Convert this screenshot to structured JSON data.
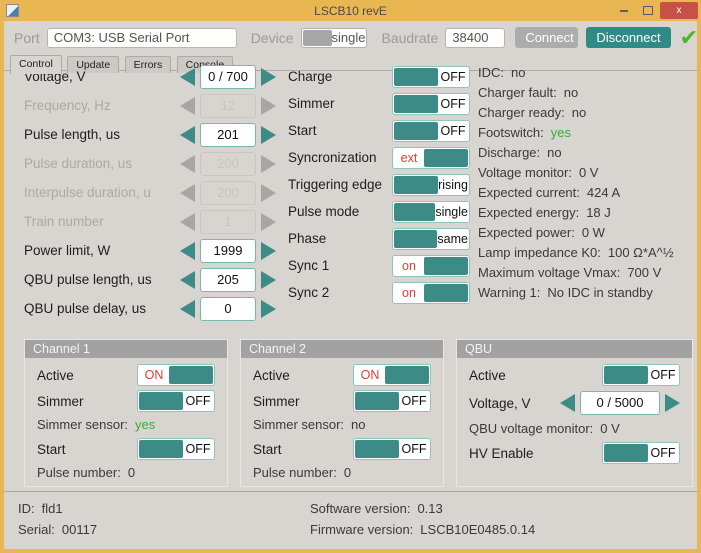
{
  "window": {
    "title": "LSCB10 revE",
    "close_glyph": "x"
  },
  "toolbar": {
    "port_label": "Port",
    "port_value": "COM3: USB Serial Port",
    "device_label": "Device",
    "device_value": "single",
    "baudrate_label": "Baudrate",
    "baudrate_value": "38400",
    "connect_label": "Connect",
    "disconnect_label": "Disconnect",
    "status_check_glyph": "✔"
  },
  "tabs": [
    {
      "label": "Control",
      "active": true
    },
    {
      "label": "Update",
      "active": false
    },
    {
      "label": "Errors",
      "active": false
    },
    {
      "label": "Console",
      "active": false
    }
  ],
  "params": [
    {
      "label": "Voltage, V",
      "value": "0 / 700",
      "enabled": true
    },
    {
      "label": "Frequency, Hz",
      "value": "12",
      "enabled": false
    },
    {
      "label": "Pulse length, us",
      "value": "201",
      "enabled": true
    },
    {
      "label": "Pulse duration, us",
      "value": "200",
      "enabled": false
    },
    {
      "label": "Interpulse duration, u",
      "value": "200",
      "enabled": false
    },
    {
      "label": "Train number",
      "value": "1",
      "enabled": false
    },
    {
      "label": "Power limit, W",
      "value": "1999",
      "enabled": true
    },
    {
      "label": "QBU pulse length, us",
      "value": "205",
      "enabled": true
    },
    {
      "label": "QBU pulse delay, us",
      "value": "0",
      "enabled": true
    }
  ],
  "toggles": [
    {
      "label": "Charge",
      "value": "OFF",
      "text_side": "right",
      "value_color": "black"
    },
    {
      "label": "Simmer",
      "value": "OFF",
      "text_side": "right",
      "value_color": "black"
    },
    {
      "label": "Start",
      "value": "OFF",
      "text_side": "right",
      "value_color": "black"
    },
    {
      "label": "Syncronization",
      "value": "ext",
      "text_side": "left",
      "value_color": "red"
    },
    {
      "label": "Triggering edge",
      "value": "rising",
      "text_side": "right",
      "value_color": "black"
    },
    {
      "label": "Pulse mode",
      "value": "single",
      "text_side": "right",
      "value_color": "black"
    },
    {
      "label": "Phase",
      "value": "same",
      "text_side": "right",
      "value_color": "black"
    },
    {
      "label": "Sync 1",
      "value": "on",
      "text_side": "left",
      "value_color": "red"
    },
    {
      "label": "Sync 2",
      "value": "on",
      "text_side": "left",
      "value_color": "red"
    }
  ],
  "status_lines": [
    {
      "label": "IDC:",
      "value": "no",
      "value_color": "normal"
    },
    {
      "label": "Charger fault:",
      "value": "no",
      "value_color": "normal"
    },
    {
      "label": "Charger ready:",
      "value": "no",
      "value_color": "normal"
    },
    {
      "label": "Footswitch:",
      "value": "yes",
      "value_color": "green"
    },
    {
      "label": "Discharge:",
      "value": "no",
      "value_color": "normal"
    },
    {
      "label": "Voltage monitor:",
      "value": "0 V",
      "value_color": "normal"
    },
    {
      "label": "Expected current:",
      "value": "424 A",
      "value_color": "normal"
    },
    {
      "label": "Expected energy:",
      "value": "18 J",
      "value_color": "normal"
    },
    {
      "label": "Expected power:",
      "value": "0 W",
      "value_color": "normal"
    },
    {
      "label": "Lamp impedance K0:",
      "value": "100 Ω*A^½",
      "value_color": "normal"
    },
    {
      "label": "Maximum voltage Vmax:",
      "value": "700 V",
      "value_color": "normal"
    },
    {
      "label": "Warning 1:",
      "value": "No IDC in standby",
      "value_color": "normal"
    }
  ],
  "channels": [
    {
      "title": "Channel 1",
      "active": {
        "label": "Active",
        "value": "ON",
        "text_side": "left",
        "value_color": "red"
      },
      "simmer": {
        "label": "Simmer",
        "value": "OFF",
        "text_side": "right",
        "value_color": "black"
      },
      "simmer_sensor": {
        "label": "Simmer sensor:",
        "value": "yes",
        "value_color": "green"
      },
      "start": {
        "label": "Start",
        "value": "OFF",
        "text_side": "right",
        "value_color": "black"
      },
      "pulse_number": {
        "label": "Pulse number:",
        "value": "0",
        "value_color": "normal"
      }
    },
    {
      "title": "Channel 2",
      "active": {
        "label": "Active",
        "value": "ON",
        "text_side": "left",
        "value_color": "red"
      },
      "simmer": {
        "label": "Simmer",
        "value": "OFF",
        "text_side": "right",
        "value_color": "black"
      },
      "simmer_sensor": {
        "label": "Simmer sensor:",
        "value": "no",
        "value_color": "normal"
      },
      "start": {
        "label": "Start",
        "value": "OFF",
        "text_side": "right",
        "value_color": "black"
      },
      "pulse_number": {
        "label": "Pulse number:",
        "value": "0",
        "value_color": "normal"
      }
    }
  ],
  "qbu": {
    "title": "QBU",
    "active_label": "Active",
    "active_value": "OFF",
    "voltage_label": "Voltage, V",
    "voltage_value": "0 / 5000",
    "monitor_label": "QBU voltage monitor:",
    "monitor_value": "0 V",
    "hv_label": "HV Enable",
    "hv_value": "OFF"
  },
  "footer": {
    "id_label": "ID:",
    "id_value": "fld1",
    "serial_label": "Serial:",
    "serial_value": "00117",
    "sw_label": "Software version:",
    "sw_value": "0.13",
    "fw_label": "Firmware version:",
    "fw_value": "LSCB10E0485.0.14"
  },
  "colors": {
    "accent_teal": "#3D8B86",
    "title_gold": "#E9B751",
    "background_gray": "#D8D4D0",
    "status_green": "#33AF33",
    "state_red": "#E23B36",
    "close_red": "#C75149"
  }
}
